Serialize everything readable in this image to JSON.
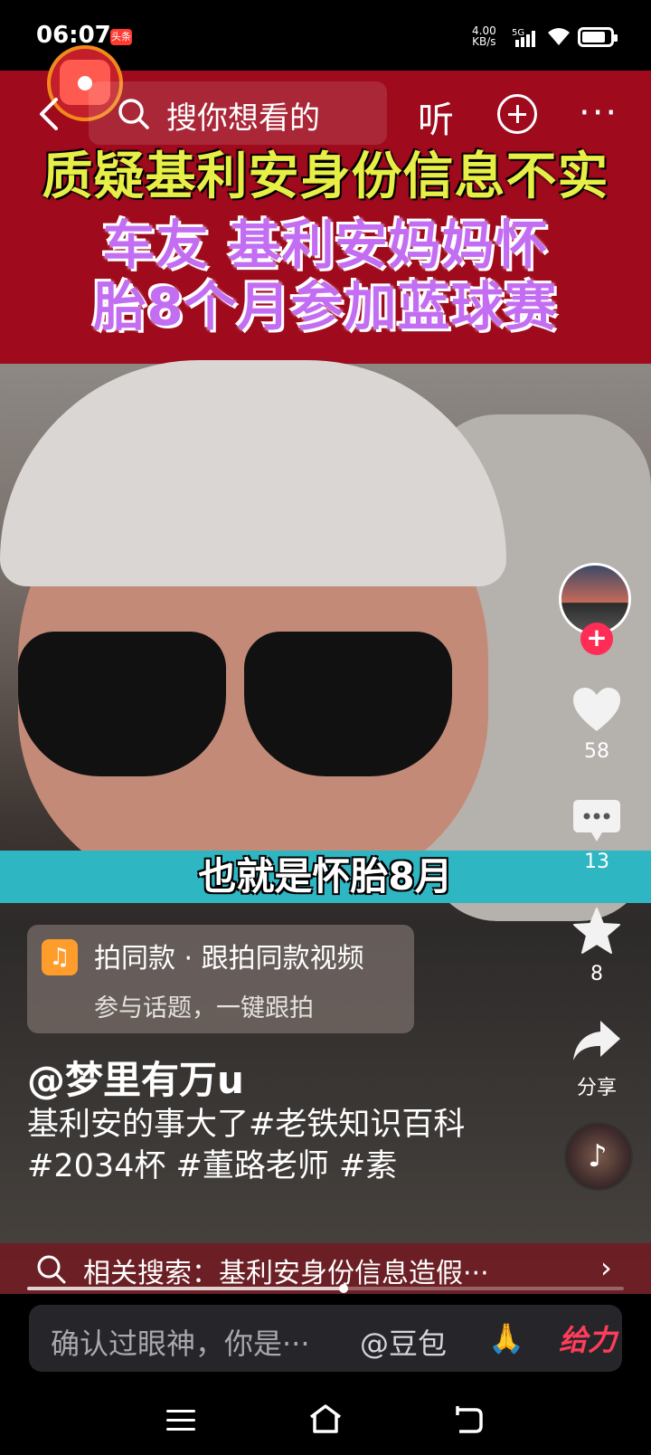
{
  "status_bar": {
    "time": "06:07",
    "badge": "头条",
    "net_speed_value": "4.00",
    "net_speed_unit": "KB/s",
    "network": "5G",
    "battery_level_pct": 85
  },
  "top_bar": {
    "search_placeholder": "搜你想看的",
    "listen_label": "听",
    "more_label": "···"
  },
  "video": {
    "headline_line1": "质疑基利安身份信息不实",
    "headline_line2": "车友 基利安妈妈怀",
    "headline_line3": "胎8个月参加蓝球赛",
    "subtitle": "也就是怀胎8月"
  },
  "rail": {
    "follow_label": "+",
    "likes": "58",
    "comments": "13",
    "favorites": "8",
    "share_label": "分享"
  },
  "template": {
    "title": "拍同款 · 跟拍同款视频",
    "subtitle": "参与话题，一键跟拍"
  },
  "post": {
    "author": "@梦里有万u",
    "description": "基利安的事大了#老铁知识百科 #2034杯 #董路老师 #素"
  },
  "related": {
    "text": "相关搜索：基利安身份信息造假···"
  },
  "progress": {
    "value_pct": 53
  },
  "comment_bar": {
    "placeholder": "确认过眼神，你是···",
    "mention": "@豆包",
    "give_label": "给力"
  },
  "colors": {
    "banner_red": "#9f0a1d",
    "headline_yellow": "#e7ee46",
    "headline_purple": "#c36ef2",
    "follow_red": "#ff2c55",
    "caption_teal": "#2eb6c3"
  }
}
